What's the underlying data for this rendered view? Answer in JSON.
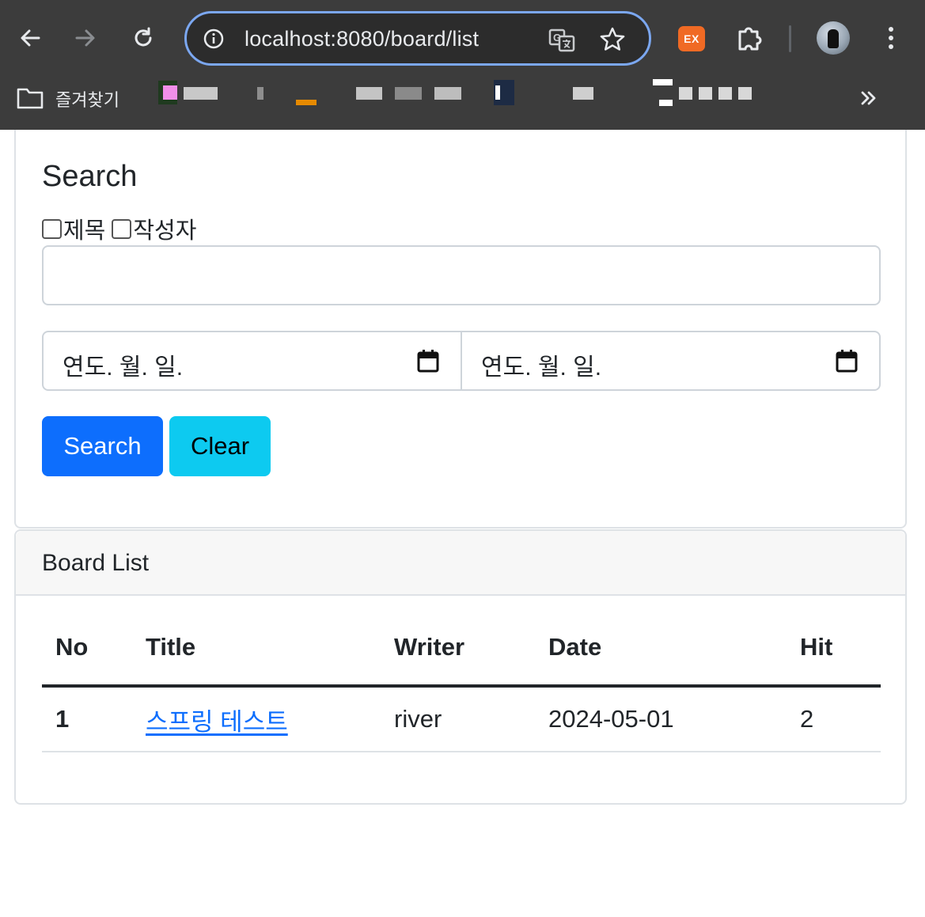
{
  "browser": {
    "url": "localhost:8080/board/list",
    "extension_badge": "EX",
    "bookmarks_folder_label": "즐겨찾기",
    "icons": [
      "back-icon",
      "forward-icon",
      "reload-icon",
      "info-icon",
      "translate-icon",
      "star-icon",
      "puzzle-icon",
      "kebab-icon",
      "folder-icon",
      "chevron-double-right-icon"
    ]
  },
  "search": {
    "title": "Search",
    "checkbox_title_label": "제목",
    "checkbox_writer_label": "작성자",
    "keyword_value": "",
    "start_date_placeholder": "연도. 월. 일.",
    "end_date_placeholder": "연도. 월. 일.",
    "search_button": "Search",
    "clear_button": "Clear",
    "colors": {
      "search_button": "#0d6efd",
      "clear_button": "#0dcaf0"
    }
  },
  "board": {
    "header": "Board List",
    "columns": [
      "No",
      "Title",
      "Writer",
      "Date",
      "Hit"
    ],
    "rows": [
      {
        "no": "1",
        "title": "스프링 테스트",
        "writer": "river",
        "date": "2024-05-01",
        "hit": "2"
      }
    ],
    "link_color": "#0d6efd"
  }
}
